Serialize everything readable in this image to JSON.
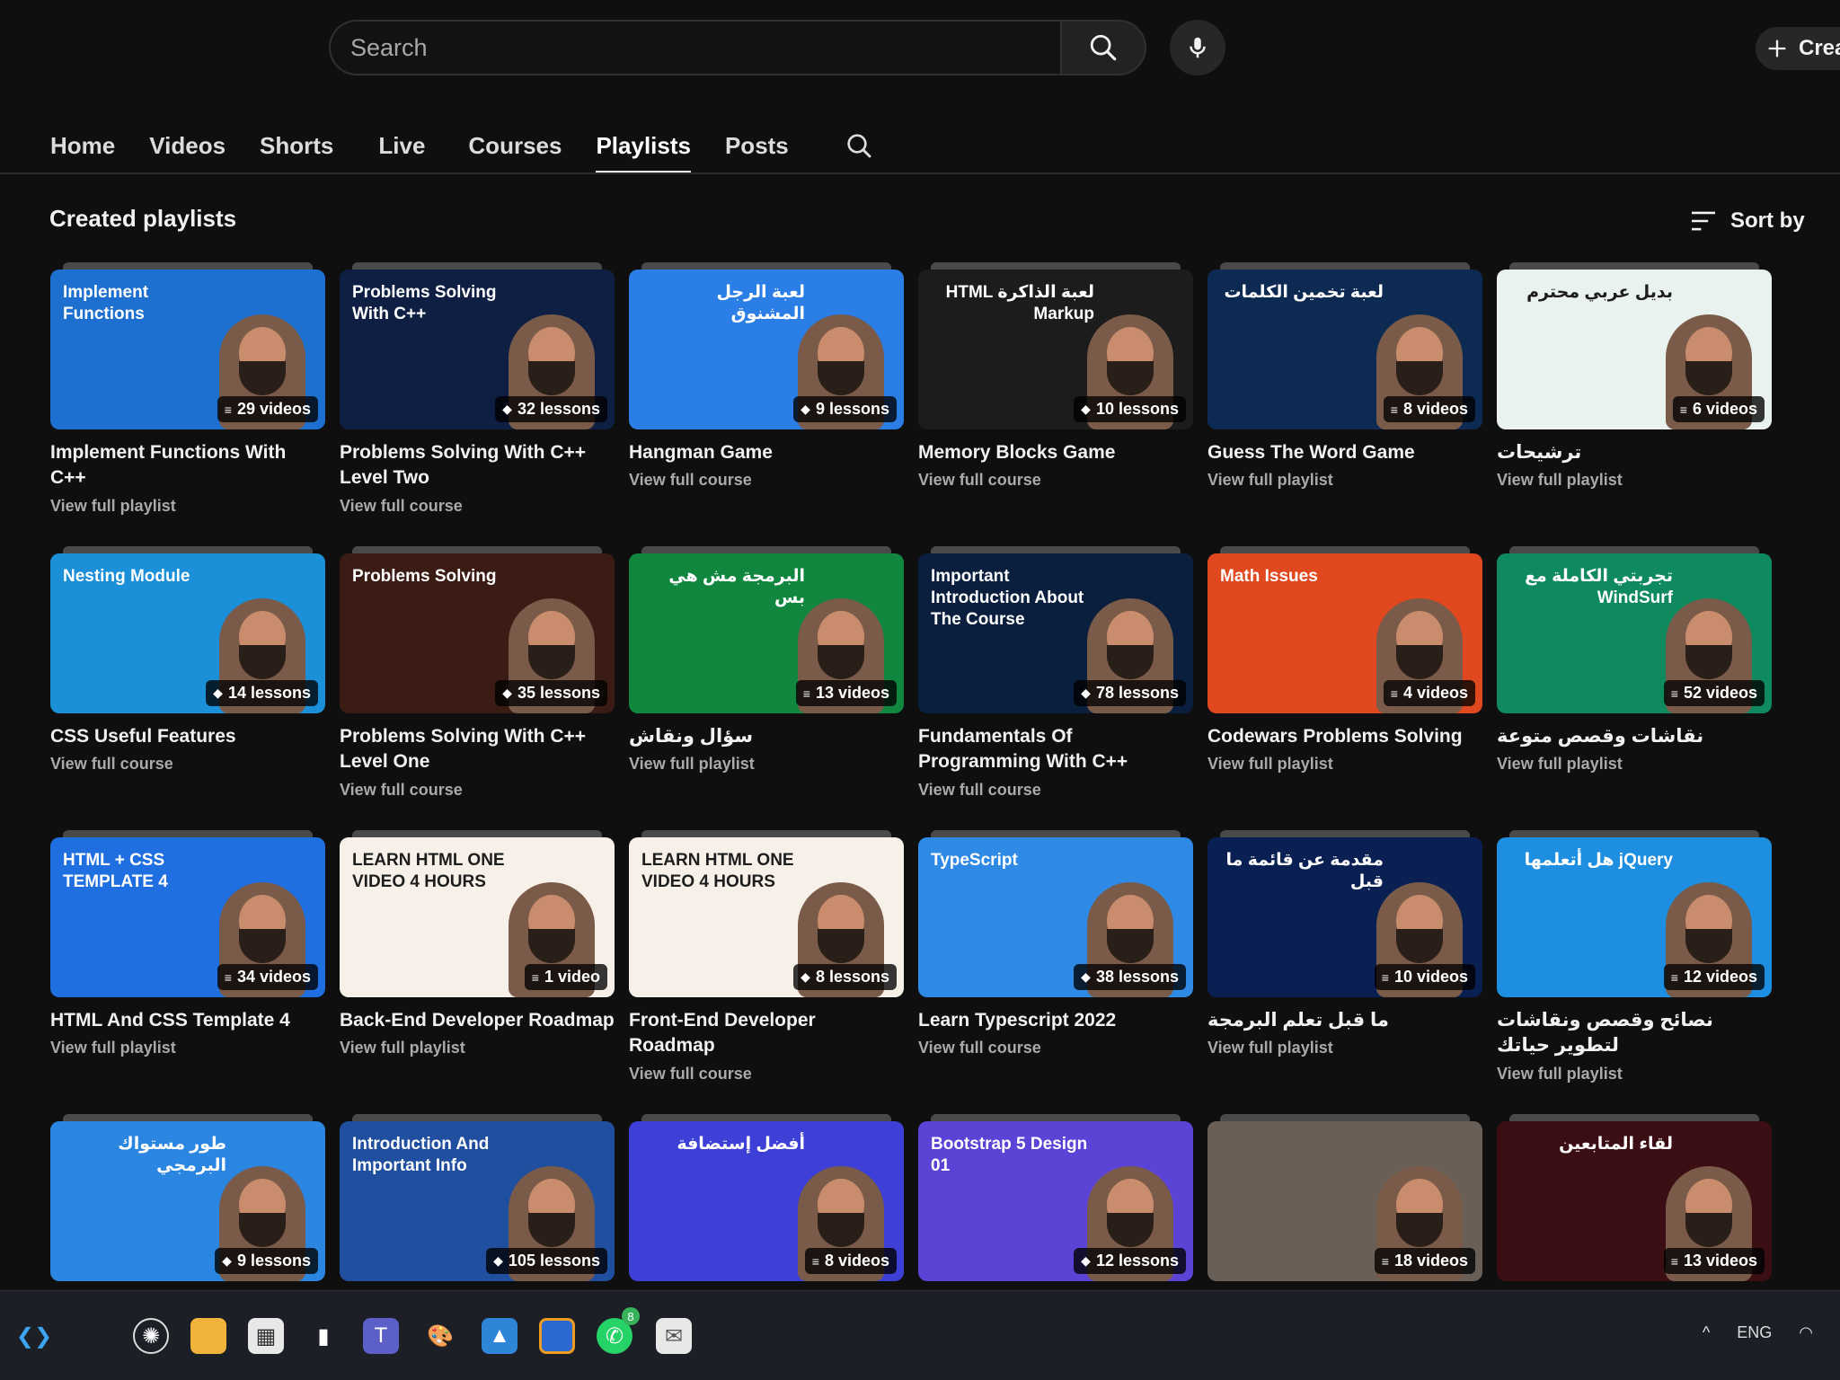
{
  "search": {
    "placeholder": "Search"
  },
  "create": {
    "label": "Crea"
  },
  "tabs": [
    {
      "label": "Home"
    },
    {
      "label": "Videos"
    },
    {
      "label": "Shorts"
    },
    {
      "label": "Live"
    },
    {
      "label": "Courses"
    },
    {
      "label": "Playlists",
      "active": true
    },
    {
      "label": "Posts"
    }
  ],
  "section": {
    "title": "Created playlists",
    "sort_label": "Sort by"
  },
  "playlists": [
    {
      "title": "Implement Functions With C++",
      "link": "View full playlist",
      "count": "29 videos",
      "thumb_text": "Implement Functions",
      "bg": "#1d6fd0"
    },
    {
      "title": "Problems Solving With C++ Level Two",
      "link": "View full course",
      "count": "32 lessons",
      "thumb_text": "Problems Solving With C++",
      "bg": "#0f1f44"
    },
    {
      "title": "Hangman Game",
      "link": "View full course",
      "count": "9 lessons",
      "thumb_text": "لعبة الرجل المشنوق",
      "bg": "#2b7ee6"
    },
    {
      "title": "Memory Blocks Game",
      "link": "View full course",
      "count": "10 lessons",
      "thumb_text": "لعبة الذاكرة HTML Markup",
      "bg": "#1c1c1c"
    },
    {
      "title": "Guess The Word Game",
      "link": "View full playlist",
      "count": "8 videos",
      "thumb_text": "لعبة تخمين الكلمات",
      "bg": "#0d2a52"
    },
    {
      "title": "ترشيحات",
      "link": "View full playlist",
      "count": "6 videos",
      "thumb_text": "بديل عربي محترم",
      "bg": "#e9f2ef"
    },
    {
      "title": "CSS Useful Features",
      "link": "View full course",
      "count": "14 lessons",
      "thumb_text": "Nesting Module",
      "bg": "#1b8fd8"
    },
    {
      "title": "Problems Solving With C++ Level One",
      "link": "View full course",
      "count": "35 lessons",
      "thumb_text": "Problems Solving",
      "bg": "#3a1c14"
    },
    {
      "title": "سؤال ونقاش",
      "link": "View full playlist",
      "count": "13 videos",
      "thumb_text": "البرمجة مش هي بس",
      "bg": "#11863f"
    },
    {
      "title": "Fundamentals Of Programming With C++",
      "link": "View full course",
      "count": "78 lessons",
      "thumb_text": "Important Introduction About The Course",
      "bg": "#0a1f3e"
    },
    {
      "title": "Codewars Problems Solving",
      "link": "View full playlist",
      "count": "4 videos",
      "thumb_text": "Math Issues",
      "bg": "#e0481f"
    },
    {
      "title": "نقاشات وقصص متوعة",
      "link": "View full playlist",
      "count": "52 videos",
      "thumb_text": "تجربتي الكاملة مع WindSurf",
      "bg": "#0f8a5e"
    },
    {
      "title": "HTML And CSS Template 4",
      "link": "View full playlist",
      "count": "34 videos",
      "thumb_text": "HTML + CSS TEMPLATE 4",
      "bg": "#1f6fe0"
    },
    {
      "title": "Back-End Developer Roadmap",
      "link": "View full playlist",
      "count": "1 video",
      "thumb_text": "LEARN HTML ONE VIDEO 4 HOURS",
      "bg": "#f6f0e8"
    },
    {
      "title": "Front-End Developer Roadmap",
      "link": "View full course",
      "count": "8 lessons",
      "thumb_text": "LEARN HTML ONE VIDEO 4 HOURS",
      "bg": "#f6f0e8"
    },
    {
      "title": "Learn Typescript 2022",
      "link": "View full course",
      "count": "38 lessons",
      "thumb_text": "TypeScript",
      "bg": "#2f8ae6"
    },
    {
      "title": "ما قبل تعلم البرمجة",
      "link": "View full playlist",
      "count": "10 videos",
      "thumb_text": "مقدمة عن قائمة ما قبل",
      "bg": "#0a1f52"
    },
    {
      "title": "نصائح وقصص ونقاشات لتطوير حياتك",
      "link": "View full playlist",
      "count": "12 videos",
      "thumb_text": "jQuery هل أتعلمها",
      "bg": "#1e8ee0"
    },
    {
      "title": "",
      "link": "",
      "count": "9 lessons",
      "thumb_text": "طور مستواك البرمجي",
      "bg": "#2a86e0"
    },
    {
      "title": "",
      "link": "",
      "count": "105 lessons",
      "thumb_text": "Introduction And Important Info",
      "bg": "#1f4f9e"
    },
    {
      "title": "",
      "link": "",
      "count": "8 videos",
      "thumb_text": "أفضل إستضافة",
      "bg": "#3d3fd6"
    },
    {
      "title": "",
      "link": "",
      "count": "12 lessons",
      "thumb_text": "Bootstrap 5 Design 01",
      "bg": "#5b43d6"
    },
    {
      "title": "",
      "link": "",
      "count": "18 videos",
      "thumb_text": "",
      "bg": "#6a5f57"
    },
    {
      "title": "",
      "link": "",
      "count": "13 videos",
      "thumb_text": "لقاء المتابعين",
      "bg": "#3a0e12"
    }
  ],
  "taskbar": {
    "lang": "ENG",
    "whatsapp_badge": "8"
  }
}
